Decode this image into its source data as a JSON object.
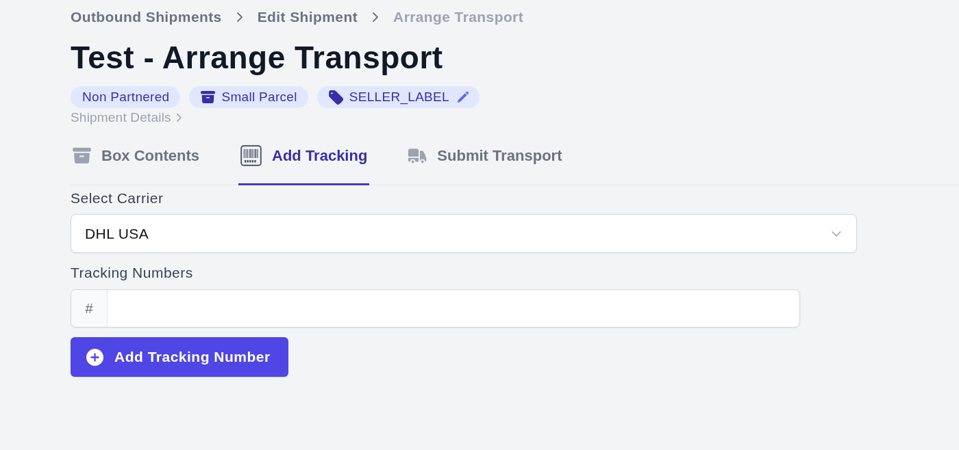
{
  "breadcrumbs": [
    {
      "label": "Outbound Shipments",
      "current": false
    },
    {
      "label": "Edit Shipment",
      "current": false
    },
    {
      "label": "Arrange Transport",
      "current": true
    }
  ],
  "title": "Test - Arrange Transport",
  "badges": [
    {
      "label": "Non Partnered",
      "kind": "plain",
      "editable": false
    },
    {
      "label": "Small Parcel",
      "kind": "box",
      "editable": false
    },
    {
      "label": "SELLER_LABEL",
      "kind": "tag",
      "editable": true
    }
  ],
  "details_link": "Shipment Details",
  "tabs": [
    {
      "label": "Box Contents",
      "kind": "box",
      "selected": false
    },
    {
      "label": "Add Tracking",
      "kind": "barcode",
      "selected": true
    },
    {
      "label": "Submit Transport",
      "kind": "truck",
      "selected": false
    }
  ],
  "carrier": {
    "label": "Select Carrier",
    "value": "DHL USA"
  },
  "tracking": {
    "label": "Tracking Numbers",
    "prefix": "#"
  },
  "add_button": "Add Tracking Number"
}
